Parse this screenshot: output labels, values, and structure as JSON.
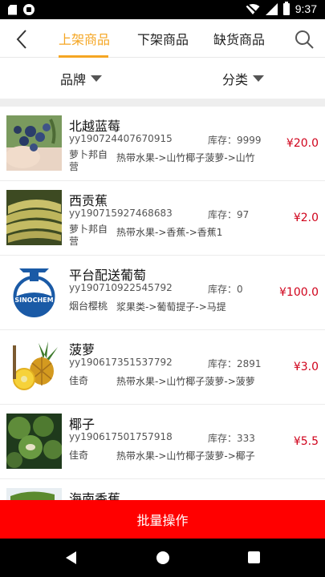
{
  "status_bar": {
    "time": "9:37"
  },
  "header": {
    "tabs": [
      {
        "label": "上架商品",
        "active": true
      },
      {
        "label": "下架商品",
        "active": false
      },
      {
        "label": "缺货商品",
        "active": false
      }
    ],
    "accent_color": "#f5a623"
  },
  "filters": {
    "brand_label": "品牌",
    "category_label": "分类"
  },
  "products": [
    {
      "name": "北越蓝莓",
      "sku": "yy190724407670915",
      "stock": "库存：9999",
      "vendor": "萝卜邦自营",
      "category": "热带水果->山竹椰子菠萝->山竹",
      "price": "¥20.0",
      "thumb": "blueberry"
    },
    {
      "name": "西贡蕉",
      "sku": "yy190715927468683",
      "stock": "库存：97",
      "vendor": "萝卜邦自营",
      "category": "热带水果->香蕉->香蕉1",
      "price": "¥2.0",
      "thumb": "banana"
    },
    {
      "name": "平台配送葡萄",
      "sku": "yy190710922545792",
      "stock": "库存：0",
      "vendor": "烟台樱桃",
      "category": "浆果类->葡萄提子->马提",
      "price": "¥100.0",
      "thumb": "sinochem-logo"
    },
    {
      "name": "菠萝",
      "sku": "yy190617351537792",
      "stock": "库存：2891",
      "vendor": "佳奇",
      "category": "热带水果->山竹椰子菠萝->菠萝",
      "price": "¥3.0",
      "thumb": "pineapple"
    },
    {
      "name": "椰子",
      "sku": "yy190617501757918",
      "stock": "库存：333",
      "vendor": "佳奇",
      "category": "热带水果->山竹椰子菠萝->椰子",
      "price": "¥5.5",
      "thumb": "coconut"
    },
    {
      "name": "海南香蕉",
      "thumb": "banana-bunch"
    }
  ],
  "logo_text": "SINOCHEM",
  "batch_button": {
    "label": "批量操作",
    "color": "#ff0000"
  },
  "price_color": "#d0021b"
}
